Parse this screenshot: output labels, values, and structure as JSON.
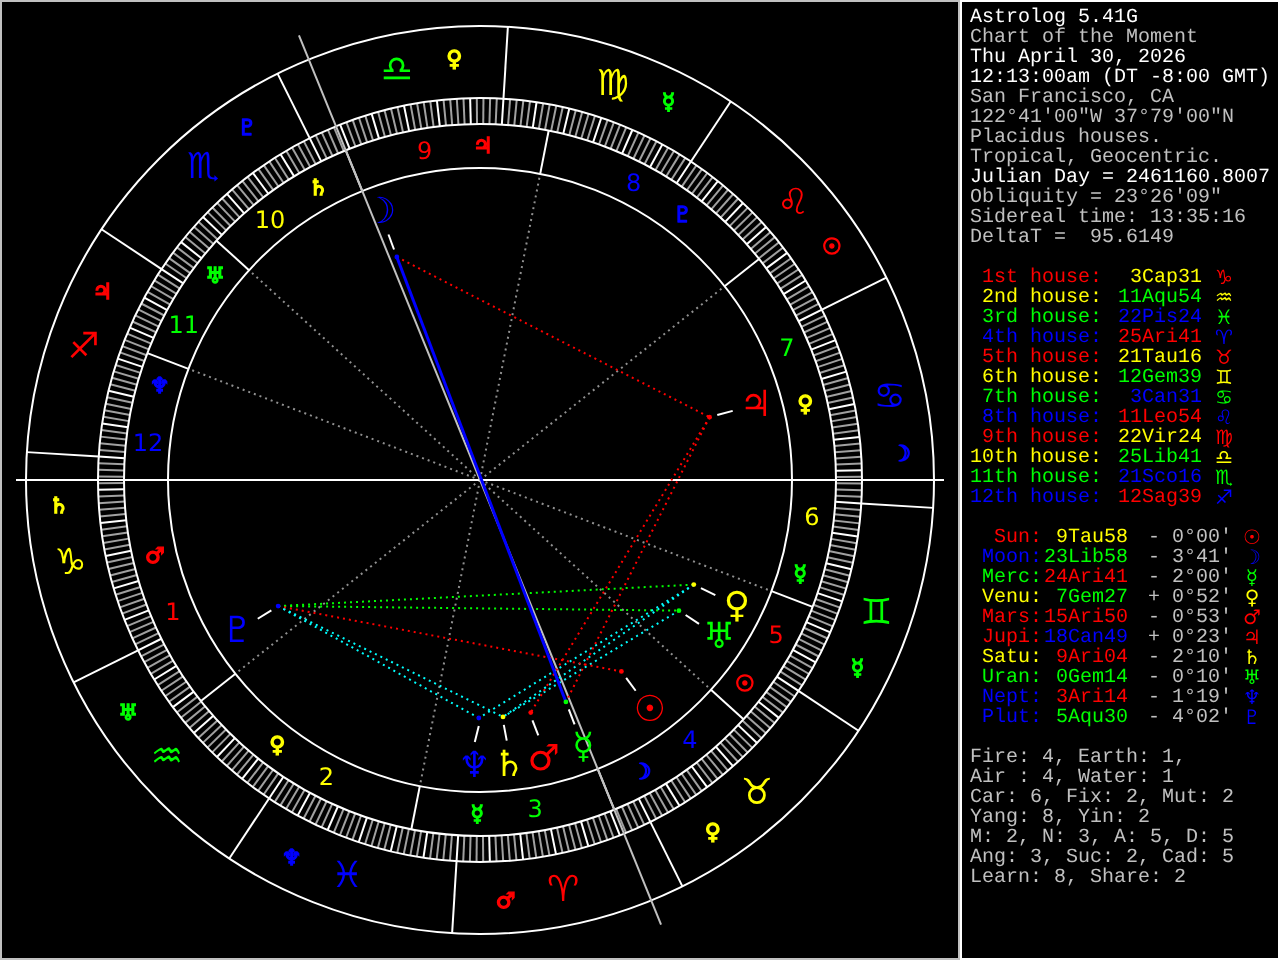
{
  "chart": {
    "signs": [
      {
        "glyph": "♈",
        "color": "#ff0000",
        "ruler": {
          "glyph": "♂",
          "color": "#ff0000"
        }
      },
      {
        "glyph": "♉",
        "color": "#ffff00",
        "ruler": {
          "glyph": "♀",
          "color": "#ffff00"
        }
      },
      {
        "glyph": "♊",
        "color": "#00ff00",
        "ruler": {
          "glyph": "☿",
          "color": "#00ff00"
        }
      },
      {
        "glyph": "♋",
        "color": "#0000ff",
        "ruler": {
          "glyph": "☽",
          "color": "#0000ff"
        }
      },
      {
        "glyph": "♌",
        "color": "#ff0000",
        "ruler": {
          "glyph": "☉",
          "color": "#ff0000"
        }
      },
      {
        "glyph": "♍",
        "color": "#ffff00",
        "ruler": {
          "glyph": "☿",
          "color": "#00ff00"
        }
      },
      {
        "glyph": "♎",
        "color": "#00ff00",
        "ruler": {
          "glyph": "♀",
          "color": "#ffff00"
        }
      },
      {
        "glyph": "♏",
        "color": "#0000ff",
        "ruler": {
          "glyph": "♇",
          "color": "#0000ff"
        }
      },
      {
        "glyph": "♐",
        "color": "#ff0000",
        "ruler": {
          "glyph": "♃",
          "color": "#ff0000"
        }
      },
      {
        "glyph": "♑",
        "color": "#ffff00",
        "ruler": {
          "glyph": "♄",
          "color": "#ffff00"
        }
      },
      {
        "glyph": "♒",
        "color": "#00ff00",
        "ruler": {
          "glyph": "♅",
          "color": "#00ff00"
        }
      },
      {
        "glyph": "♓",
        "color": "#0000ff",
        "ruler": {
          "glyph": "♆",
          "color": "#0000ff"
        }
      }
    ],
    "houses": [
      {
        "number": "1",
        "color": "#ff0000",
        "ruler": {
          "glyph": "♂",
          "color": "#ff0000"
        }
      },
      {
        "number": "2",
        "color": "#ffff00",
        "ruler": {
          "glyph": "♀",
          "color": "#ffff00"
        }
      },
      {
        "number": "3",
        "color": "#00ff00",
        "ruler": {
          "glyph": "☿",
          "color": "#00ff00"
        }
      },
      {
        "number": "4",
        "color": "#0000ff",
        "ruler": {
          "glyph": "☽",
          "color": "#0000ff"
        }
      },
      {
        "number": "5",
        "color": "#ff0000",
        "ruler": {
          "glyph": "☉",
          "color": "#ff0000"
        }
      },
      {
        "number": "6",
        "color": "#ffff00",
        "ruler": {
          "glyph": "☿",
          "color": "#00ff00"
        }
      },
      {
        "number": "7",
        "color": "#00ff00",
        "ruler": {
          "glyph": "♀",
          "color": "#ffff00"
        }
      },
      {
        "number": "8",
        "color": "#0000ff",
        "ruler": {
          "glyph": "♇",
          "color": "#0000ff"
        }
      },
      {
        "number": "9",
        "color": "#ff0000",
        "ruler": {
          "glyph": "♃",
          "color": "#ff0000"
        }
      },
      {
        "number": "10",
        "color": "#ffff00",
        "ruler": {
          "glyph": "♄",
          "color": "#ffff00"
        }
      },
      {
        "number": "11",
        "color": "#00ff00",
        "ruler": {
          "glyph": "♅",
          "color": "#00ff00"
        }
      },
      {
        "number": "12",
        "color": "#0000ff",
        "ruler": {
          "glyph": "♆",
          "color": "#0000ff"
        }
      }
    ],
    "planets": [
      {
        "glyph": "☉",
        "color": "#ff0000"
      },
      {
        "glyph": "☽",
        "color": "#0000ff"
      },
      {
        "glyph": "☿",
        "color": "#00ff00"
      },
      {
        "glyph": "♀",
        "color": "#ffff00"
      },
      {
        "glyph": "♂",
        "color": "#ff0000"
      },
      {
        "glyph": "♃",
        "color": "#ff0000"
      },
      {
        "glyph": "♄",
        "color": "#ffff00"
      },
      {
        "glyph": "♅",
        "color": "#00ff00"
      },
      {
        "glyph": "♆",
        "color": "#0000ff"
      },
      {
        "glyph": "♇",
        "color": "#0000ff"
      }
    ]
  },
  "info_lines": [
    {
      "text": "Astrolog 5.41G",
      "bright": true
    },
    {
      "text": "Chart of the Moment",
      "bright": false
    },
    {
      "text": "Thu April 30, 2026",
      "bright": true
    },
    {
      "text": "12:13:00am (DT -8:00 GMT)",
      "bright": true
    },
    {
      "text": "San Francisco, CA",
      "bright": false
    },
    {
      "text": "122°41'00\"W 37°79'00\"N",
      "bright": false
    },
    {
      "text": "Placidus houses.",
      "bright": false
    },
    {
      "text": "Tropical, Geocentric.",
      "bright": false
    },
    {
      "text": "Julian Day = 2461160.8007",
      "bright": true
    },
    {
      "text": "Obliquity = 23°26'09\"",
      "bright": false
    },
    {
      "text": "Sidereal time: 13:35:16",
      "bright": false
    },
    {
      "text": "DeltaT =  95.6149",
      "bright": false
    }
  ],
  "house_cusps": [
    {
      "label": "1st house:",
      "color": "#ff0000",
      "cusp": {
        "text": "3Cap31",
        "color": "#ffff00"
      },
      "glyph": "♑"
    },
    {
      "label": "2nd house:",
      "color": "#ffff00",
      "cusp": {
        "text": "11Aqu54",
        "color": "#00ff00"
      },
      "glyph": "♒"
    },
    {
      "label": "3rd house:",
      "color": "#00ff00",
      "cusp": {
        "text": "22Pis24",
        "color": "#0000ff"
      },
      "glyph": "♓"
    },
    {
      "label": "4th house:",
      "color": "#0000ff",
      "cusp": {
        "text": "25Ari41",
        "color": "#ff0000"
      },
      "glyph": "♈"
    },
    {
      "label": "5th house:",
      "color": "#ff0000",
      "cusp": {
        "text": "21Tau16",
        "color": "#ffff00"
      },
      "glyph": "♉"
    },
    {
      "label": "6th house:",
      "color": "#ffff00",
      "cusp": {
        "text": "12Gem39",
        "color": "#00ff00"
      },
      "glyph": "♊"
    },
    {
      "label": "7th house:",
      "color": "#00ff00",
      "cusp": {
        "text": "3Can31",
        "color": "#0000ff"
      },
      "glyph": "♋"
    },
    {
      "label": "8th house:",
      "color": "#0000ff",
      "cusp": {
        "text": "11Leo54",
        "color": "#ff0000"
      },
      "glyph": "♌"
    },
    {
      "label": "9th house:",
      "color": "#ff0000",
      "cusp": {
        "text": "22Vir24",
        "color": "#ffff00"
      },
      "glyph": "♍"
    },
    {
      "label": "10th house:",
      "color": "#ffff00",
      "cusp": {
        "text": "25Lib41",
        "color": "#00ff00"
      },
      "glyph": "♎"
    },
    {
      "label": "11th house:",
      "color": "#00ff00",
      "cusp": {
        "text": "21Sco16",
        "color": "#0000ff"
      },
      "glyph": "♏"
    },
    {
      "label": "12th house:",
      "color": "#0000ff",
      "cusp": {
        "text": "12Sag39",
        "color": "#ff0000"
      },
      "glyph": "♐"
    }
  ],
  "planet_positions": [
    {
      "name": "Sun:",
      "color": "#ff0000",
      "position": {
        "text": "9Tau58",
        "color": "#ffff00"
      },
      "motion": "- 0°00'",
      "glyph": "☉"
    },
    {
      "name": "Moon:",
      "color": "#0000ff",
      "position": {
        "text": "23Lib58",
        "color": "#00ff00"
      },
      "motion": "- 3°41'",
      "glyph": "☽"
    },
    {
      "name": "Merc:",
      "color": "#00ff00",
      "position": {
        "text": "24Ari41",
        "color": "#ff0000"
      },
      "motion": "- 2°00'",
      "glyph": "☿"
    },
    {
      "name": "Venu:",
      "color": "#ffff00",
      "position": {
        "text": "7Gem27",
        "color": "#00ff00"
      },
      "motion": "+ 0°52'",
      "glyph": "♀"
    },
    {
      "name": "Mars:",
      "color": "#ff0000",
      "position": {
        "text": "15Ari50",
        "color": "#ff0000"
      },
      "motion": "- 0°53'",
      "glyph": "♂"
    },
    {
      "name": "Jupi:",
      "color": "#ff0000",
      "position": {
        "text": "18Can49",
        "color": "#0000ff"
      },
      "motion": "+ 0°23'",
      "glyph": "♃"
    },
    {
      "name": "Satu:",
      "color": "#ffff00",
      "position": {
        "text": "9Ari04",
        "color": "#ff0000"
      },
      "motion": "- 2°10'",
      "glyph": "♄"
    },
    {
      "name": "Uran:",
      "color": "#00ff00",
      "position": {
        "text": "0Gem14",
        "color": "#00ff00"
      },
      "motion": "- 0°10'",
      "glyph": "♅"
    },
    {
      "name": "Nept:",
      "color": "#0000ff",
      "position": {
        "text": "3Ari14",
        "color": "#ff0000"
      },
      "motion": "- 1°19'",
      "glyph": "♆"
    },
    {
      "name": "Plut:",
      "color": "#0000ff",
      "position": {
        "text": "5Aqu30",
        "color": "#00ff00"
      },
      "motion": "- 4°02'",
      "glyph": "♇"
    }
  ],
  "element_summary": [
    "Fire: 4, Earth: 1,",
    "Air : 4, Water: 1",
    "Car: 6, Fix: 2, Mut: 2",
    "Yang: 8, Yin: 2",
    "M: 2, N: 3, A: 5, D: 5",
    "Ang: 3, Suc: 2, Cad: 5",
    "Learn: 8, Share: 2"
  ]
}
